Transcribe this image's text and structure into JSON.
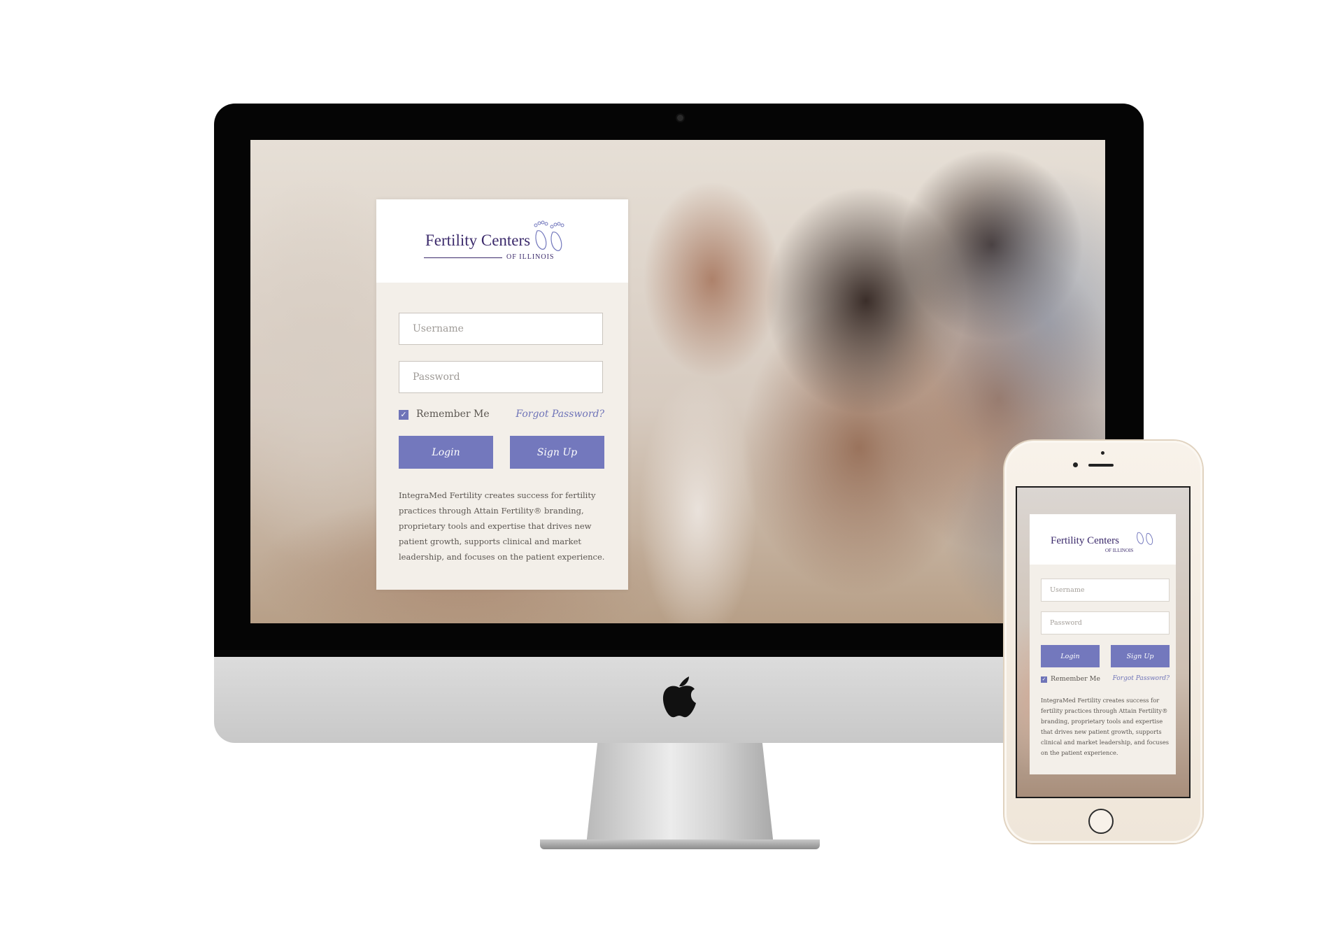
{
  "brand": {
    "name": "Fertility Centers",
    "subname": "OF ILLINOIS"
  },
  "login_form": {
    "username_placeholder": "Username",
    "password_placeholder": "Password",
    "remember_label": "Remember Me",
    "remember_checked": true,
    "forgot_label": "Forgot Password?",
    "login_label": "Login",
    "signup_label": "Sign Up",
    "blurb": "IntegraMed Fertility creates success for fertility practices through Attain Fertility® branding, proprietary tools and expertise that drives new patient growth, supports clinical and market leadership, and focuses on the patient experience."
  },
  "colors": {
    "accent": "#7378bd",
    "brand_text": "#3b2a6b",
    "card_background": "#f3efe9"
  },
  "icons": {
    "logo_mark": "baby-feet-icon",
    "checkbox": "checkmark-icon",
    "device_logo": "apple-logo"
  }
}
